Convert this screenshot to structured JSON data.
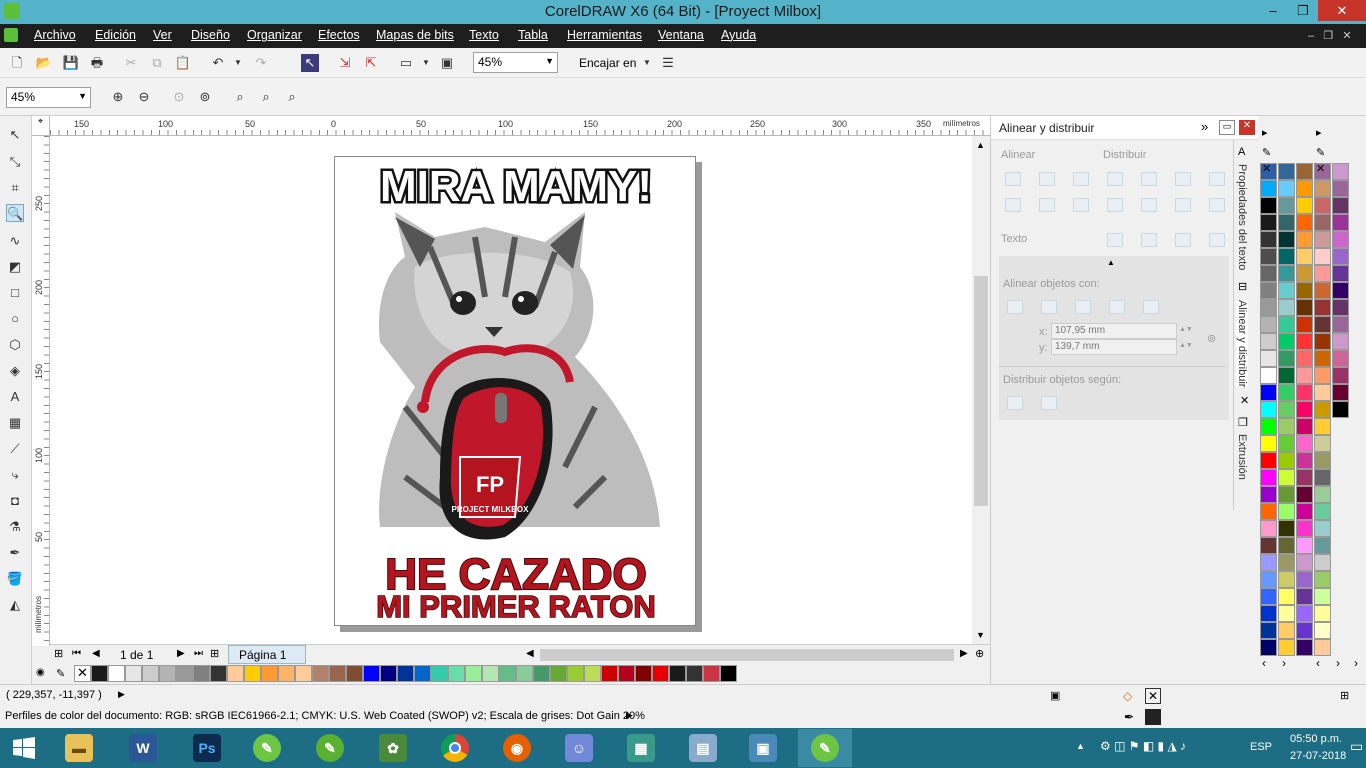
{
  "title": "CorelDRAW X6 (64 Bit) - [Proyect Milbox]",
  "menu": [
    "Archivo",
    "Edición",
    "Ver",
    "Diseño",
    "Organizar",
    "Efectos",
    "Mapas de bits",
    "Texto",
    "Tabla",
    "Herramientas",
    "Ventana",
    "Ayuda"
  ],
  "toolbar": {
    "zoom_value": "45%",
    "snap_label": "Encajar en"
  },
  "propbar": {
    "zoom_value": "45%"
  },
  "ruler": {
    "h_ticks": [
      "150",
      "100",
      "50",
      "0",
      "50",
      "100",
      "150",
      "200",
      "250",
      "300",
      "350"
    ],
    "h_unit": "milímetros",
    "v_ticks": [
      "250",
      "200",
      "150",
      "100",
      "50"
    ],
    "v_unit": "milímetros"
  },
  "artwork": {
    "headline": "MIRA MAMY!",
    "line1": "HE CAZADO",
    "line2": "MI PRIMER RATON",
    "logo_text": "PROJECT MILKBOX"
  },
  "pagebar": {
    "page_count": "1 de 1",
    "page_tab": "Página 1"
  },
  "docker": {
    "title": "Alinear y distribuir",
    "align_label": "Alinear",
    "distribute_label": "Distribuir",
    "text_label": "Texto",
    "align_with_label": "Alinear objetos con:",
    "x_label": "x:",
    "x_value": "107,95 mm",
    "y_label": "y:",
    "y_value": "139,7 mm",
    "distribute_by_label": "Distribuir objetos según:",
    "tabs": [
      "Propiedades del texto",
      "Alinear y distribuir",
      "Extrusión"
    ]
  },
  "status": {
    "coords": "( 229,357, -11,397 )",
    "profile": "Perfiles de color del documento: RGB: sRGB IEC61966-2.1; CMYK: U.S. Web Coated (SWOP) v2; Escala de grises: Dot Gain 20%"
  },
  "tray": {
    "lang": "ESP",
    "time": "05:50 p.m.",
    "date": "27-07-2018"
  },
  "palette_h": [
    "#1a1a1a",
    "#ffffff",
    "#e6e6e6",
    "#cccccc",
    "#b3b3b3",
    "#999999",
    "#808080",
    "#333333",
    "#ffcc99",
    "#ffcc00",
    "#ff9933",
    "#ffb366",
    "#ffcc99",
    "#b3806b",
    "#99664d",
    "#804d33",
    "#0000ff",
    "#000080",
    "#003399",
    "#0066cc",
    "#33ccaa",
    "#66ddaa",
    "#99ee99",
    "#b3e6b3",
    "#66bb88",
    "#88cc99",
    "#449966",
    "#66aa33",
    "#99cc33",
    "#bbdd55",
    "#cc0000",
    "#b3001b",
    "#800000",
    "#e60000",
    "#1a1a1a",
    "#333333",
    "#cc3344",
    "#000000"
  ],
  "palette_v": [
    [
      "#2d5fa8",
      "#00aaff",
      "#000000",
      "#1a1a1a",
      "#333333",
      "#4d4d4d",
      "#666666",
      "#808080",
      "#999999",
      "#b3b3b3",
      "#cccccc",
      "#e6e6e6",
      "#ffffff",
      "#0000ff",
      "#00ffff",
      "#00ff00",
      "#ffff00",
      "#ff0000",
      "#ff00ff",
      "#9900cc",
      "#ff6600",
      "#ff99cc",
      "#663333",
      "#9999ff",
      "#6699ff",
      "#3366ff",
      "#0033cc",
      "#003399",
      "#000066"
    ],
    [
      "#336699",
      "#66ccff",
      "#669999",
      "#336666",
      "#003333",
      "#006666",
      "#339999",
      "#66cccc",
      "#99cccc",
      "#33cc99",
      "#00cc66",
      "#339966",
      "#006633",
      "#33cc66",
      "#66cc66",
      "#99cc66",
      "#66cc33",
      "#99cc00",
      "#ccff33",
      "#669933",
      "#99ff66",
      "#333300",
      "#666633",
      "#999966",
      "#cccc66",
      "#ffff66",
      "#ffff99",
      "#ffcc66",
      "#ffcc33"
    ],
    [
      "#996633",
      "#ff9900",
      "#ffcc00",
      "#ff6600",
      "#ff9933",
      "#ffcc66",
      "#cc9933",
      "#996600",
      "#663300",
      "#cc3300",
      "#ff3333",
      "#ff6666",
      "#ff9999",
      "#ff3366",
      "#ff0066",
      "#cc0066",
      "#ff66cc",
      "#cc3399",
      "#993366",
      "#660033",
      "#cc0099",
      "#ff33cc",
      "#ff99ff",
      "#cc99cc",
      "#9966cc",
      "#663399",
      "#9966ff",
      "#6633cc",
      "#330066"
    ],
    [
      "#996699",
      "#cc9966",
      "#cc6666",
      "#996666",
      "#cc9999",
      "#ffcccc",
      "#ff9999",
      "#cc6633",
      "#993333",
      "#663333",
      "#993300",
      "#cc6600",
      "#ff9966",
      "#ffcc99",
      "#cc9900",
      "#ffcc33",
      "#cccc99",
      "#999966",
      "#666666",
      "#99cc99",
      "#66cc99",
      "#99cccc",
      "#669999",
      "#cccccc",
      "#99cc66",
      "#ccff99",
      "#ffff99",
      "#ffffcc",
      "#ffcc99"
    ],
    [
      "#cc99cc",
      "#996699",
      "#663366",
      "#993399",
      "#cc66cc",
      "#9966cc",
      "#663399",
      "#330066",
      "#663366",
      "#996699",
      "#cc99cc",
      "#cc6699",
      "#993366",
      "#660033",
      "#000000"
    ]
  ],
  "colors": {
    "title_bar": "#54b3c9",
    "menu_bar": "#1e1e1e",
    "taskbar": "#1d6d84",
    "art_red": "#b3141e",
    "mouse_red": "#c0182a"
  },
  "taskbar_apps": [
    "file-explorer-icon",
    "word-icon",
    "photoshop-icon",
    "coreldraw-icon",
    "coreldraw-alt-icon",
    "corel-paint-icon",
    "chrome-icon",
    "firefox-icon",
    "discord-icon",
    "blocks-icon",
    "document-icon",
    "photo-viewer-icon",
    "coreldraw-active-icon"
  ]
}
